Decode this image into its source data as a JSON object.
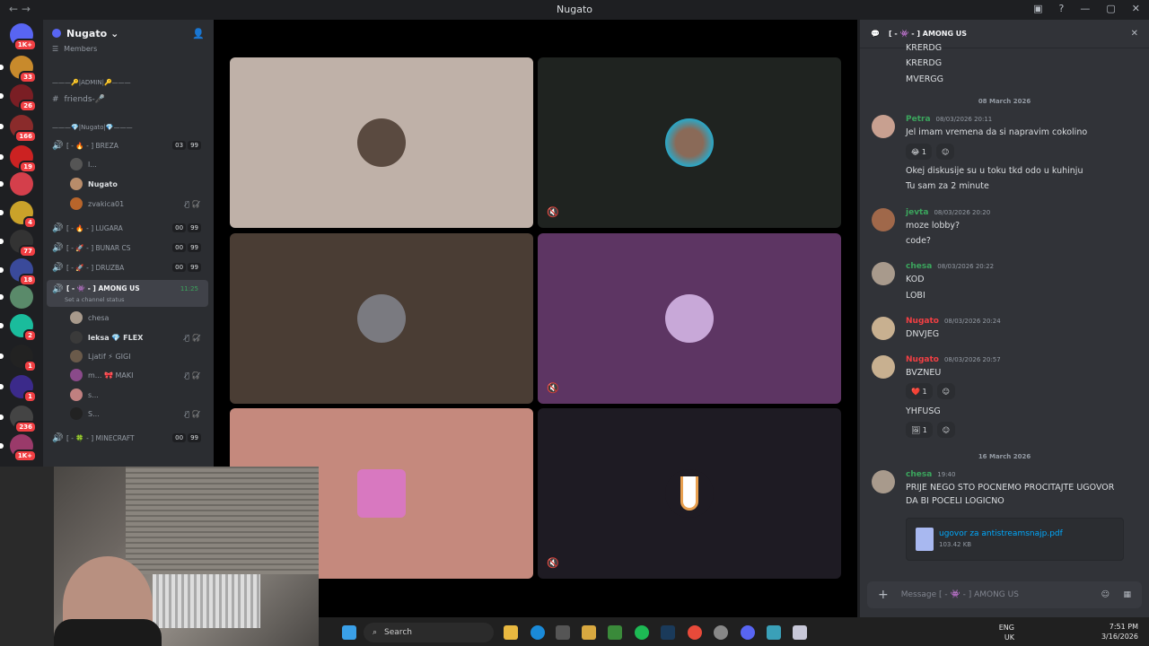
{
  "window": {
    "title": "Nugato",
    "back": "←",
    "forward": "→"
  },
  "servers": [
    {
      "badge": "1K+",
      "color": "#5865f2"
    },
    {
      "badge": "33",
      "color": "#c88a2c"
    },
    {
      "badge": "26",
      "color": "#7a1e24"
    },
    {
      "badge": "166",
      "color": "#8a2b2b"
    },
    {
      "badge": "19",
      "color": "#c22"
    },
    {
      "badge": "",
      "color": "#d43f4b"
    },
    {
      "badge": "4",
      "color": "#caa22a"
    },
    {
      "badge": "77",
      "color": "#333"
    },
    {
      "badge": "18",
      "color": "#3a4a9a"
    },
    {
      "badge": "",
      "color": "#5a8a6a"
    },
    {
      "badge": "2",
      "color": "#1abc9c"
    },
    {
      "badge": "1",
      "color": "#222"
    },
    {
      "badge": "1",
      "color": "#3b2a8a"
    },
    {
      "badge": "236",
      "color": "#444"
    },
    {
      "badge": "1K+",
      "color": "#9a3a6a"
    }
  ],
  "guild": {
    "name": "Nugato",
    "chevron": "⌄"
  },
  "channels": {
    "members": "Members",
    "admin_cat": "———🔑|ADMIN|🔑———",
    "friends": "friends-🎤",
    "nugato_cat": "———💎|Nugato|💎———",
    "voice": [
      {
        "name": "[ - 🔥 - ]   BREZA",
        "a": "03",
        "b": "99"
      },
      {
        "name": "[ - 🔥 - ]   LUGARA",
        "a": "00",
        "b": "99"
      },
      {
        "name": "[ - 🚀 - ]   BUNAR CS",
        "a": "00",
        "b": "99"
      },
      {
        "name": "[ - 🚀 - ]   DRUZBA",
        "a": "00",
        "b": "99"
      },
      {
        "name": "[ - 👾 - ]   AMONG US",
        "a": "11:25",
        "b": ""
      },
      {
        "name": "[ - 🍀 - ]   MINECRAFT",
        "a": "00",
        "b": "99"
      }
    ],
    "status_hint": "Set a channel status",
    "breza_users": [
      "l...",
      "Nugato",
      "zvakica01"
    ],
    "among_users": [
      "chesa",
      "leksa  💎 FLEX",
      "Ljatif  ⚡ GIGI",
      "m...  🎀 MAKI",
      "s...",
      "S..."
    ],
    "mute_icons": "🎙̸ 🎧̸"
  },
  "tiles": {
    "muted_icon": "🔇"
  },
  "chat": {
    "header": "[ - 👾 - ]  AMONG US",
    "close": "✕",
    "old_lines": [
      "KRERDG",
      "KRERDG",
      "MVERGG"
    ],
    "date1": "08 March 2026",
    "date2": "16 March 2026",
    "messages": [
      {
        "author": "Petra",
        "color": "#3ba55d",
        "time": "08/03/2026 20:11",
        "lines": [
          "Jel imam vremena da si napravim cokolino"
        ]
      },
      {
        "lines2": [
          "Okej diskusije su u toku tkd odo u kuhinju",
          "Tu sam za 2 minute"
        ]
      },
      {
        "author": "jevta",
        "color": "#3ba55d",
        "time": "08/03/2026 20:20",
        "lines": [
          "moze lobby?",
          "code?"
        ]
      },
      {
        "author": "chesa",
        "color": "#3ba55d",
        "time": "08/03/2026 20:22",
        "lines": [
          "KOD",
          "LOBI"
        ]
      },
      {
        "author": "Nugato",
        "color": "#f23f43",
        "time": "08/03/2026 20:24",
        "lines": [
          "DNVJEG"
        ]
      },
      {
        "author": "Nugato",
        "color": "#f23f43",
        "time": "08/03/2026 20:57",
        "lines": [
          "BVZNEU"
        ]
      },
      {
        "lines2": [
          "YHFUSG"
        ]
      },
      {
        "author": "chesa",
        "color": "#3ba55d",
        "time": "19:40",
        "lines": [
          "PRIJE NEGO STO POCNEMO PROCITAJTE UGOVOR",
          "DA BI POCELI LOGICNO"
        ]
      }
    ],
    "reactions": [
      "😂 1",
      "❤️ 1",
      "🖼 1"
    ],
    "attachment": {
      "name": "ugovor za antistreamsnajp.pdf",
      "size": "103.42 KB"
    },
    "composer_placeholder": "Message  [ - 👾 - ]  AMONG US"
  },
  "taskbar": {
    "search": "Search",
    "lang1": "ENG",
    "lang2": "UK",
    "time": "7:51 PM",
    "date": "3/16/2026"
  }
}
